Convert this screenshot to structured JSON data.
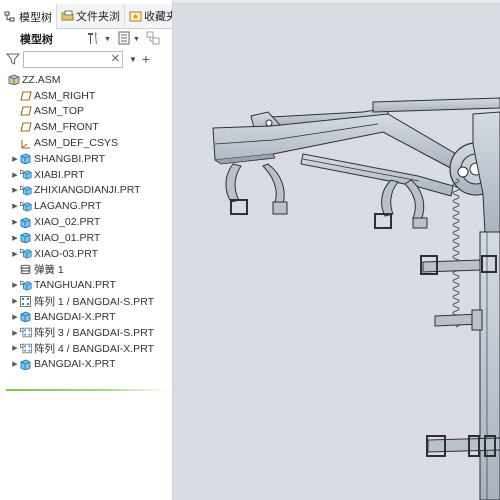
{
  "tabs": [
    {
      "label": "模型树",
      "icon": "model-tree-icon"
    },
    {
      "label": "文件夹浏",
      "icon": "folder-browser-icon"
    },
    {
      "label": "收藏夹",
      "icon": "favorites-icon"
    }
  ],
  "toolbar": {
    "title": "模型树",
    "buttons": [
      "settings-icon",
      "tree-columns-icon",
      "filter-tree-icon"
    ]
  },
  "search": {
    "value": "",
    "placeholder": ""
  },
  "tree": {
    "items": [
      {
        "label": "ZZ.ASM",
        "icon": "assembly-icon",
        "level": 0,
        "expandable": false
      },
      {
        "label": "ASM_RIGHT",
        "icon": "datum-plane-icon",
        "level": 1,
        "expandable": false
      },
      {
        "label": "ASM_TOP",
        "icon": "datum-plane-icon",
        "level": 1,
        "expandable": false
      },
      {
        "label": "ASM_FRONT",
        "icon": "datum-plane-icon",
        "level": 1,
        "expandable": false
      },
      {
        "label": "ASM_DEF_CSYS",
        "icon": "csys-icon",
        "level": 1,
        "expandable": false
      },
      {
        "label": "SHANGBI.PRT",
        "icon": "part-icon",
        "level": 1,
        "expandable": true
      },
      {
        "label": "XIABI.PRT",
        "icon": "part-constraint-icon",
        "level": 1,
        "expandable": true
      },
      {
        "label": "ZHIXIANGDIANJI.PRT",
        "icon": "part-constraint-icon",
        "level": 1,
        "expandable": true
      },
      {
        "label": "LAGANG.PRT",
        "icon": "part-constraint-icon",
        "level": 1,
        "expandable": true
      },
      {
        "label": "XIAO_02.PRT",
        "icon": "part-icon",
        "level": 1,
        "expandable": true
      },
      {
        "label": "XIAO_01.PRT",
        "icon": "part-icon",
        "level": 1,
        "expandable": true
      },
      {
        "label": "XIAO-03.PRT",
        "icon": "part-constraint-icon",
        "level": 1,
        "expandable": true
      },
      {
        "label": "弹簧 1",
        "icon": "spring-icon",
        "level": 1,
        "expandable": false
      },
      {
        "label": "TANGHUAN.PRT",
        "icon": "part-constraint-icon",
        "level": 1,
        "expandable": true
      },
      {
        "label": "阵列 1 / BANGDAI-S.PRT",
        "icon": "pattern-icon",
        "level": 1,
        "expandable": true
      },
      {
        "label": "BANGDAI-X.PRT",
        "icon": "part-icon",
        "level": 1,
        "expandable": true
      },
      {
        "label": "阵列 3 / BANGDAI-S.PRT",
        "icon": "pattern-constraint-icon",
        "level": 1,
        "expandable": true
      },
      {
        "label": "阵列 4 / BANGDAI-X.PRT",
        "icon": "pattern-constraint-icon",
        "level": 1,
        "expandable": true
      },
      {
        "label": "BANGDAI-X.PRT",
        "icon": "part-icon",
        "level": 1,
        "expandable": true
      }
    ]
  },
  "colors": {
    "viewport_bg": "#d9dde3",
    "part_color": "#b9c1cb",
    "edge_color": "#2c3036",
    "tree_green": "#7cc44a"
  }
}
